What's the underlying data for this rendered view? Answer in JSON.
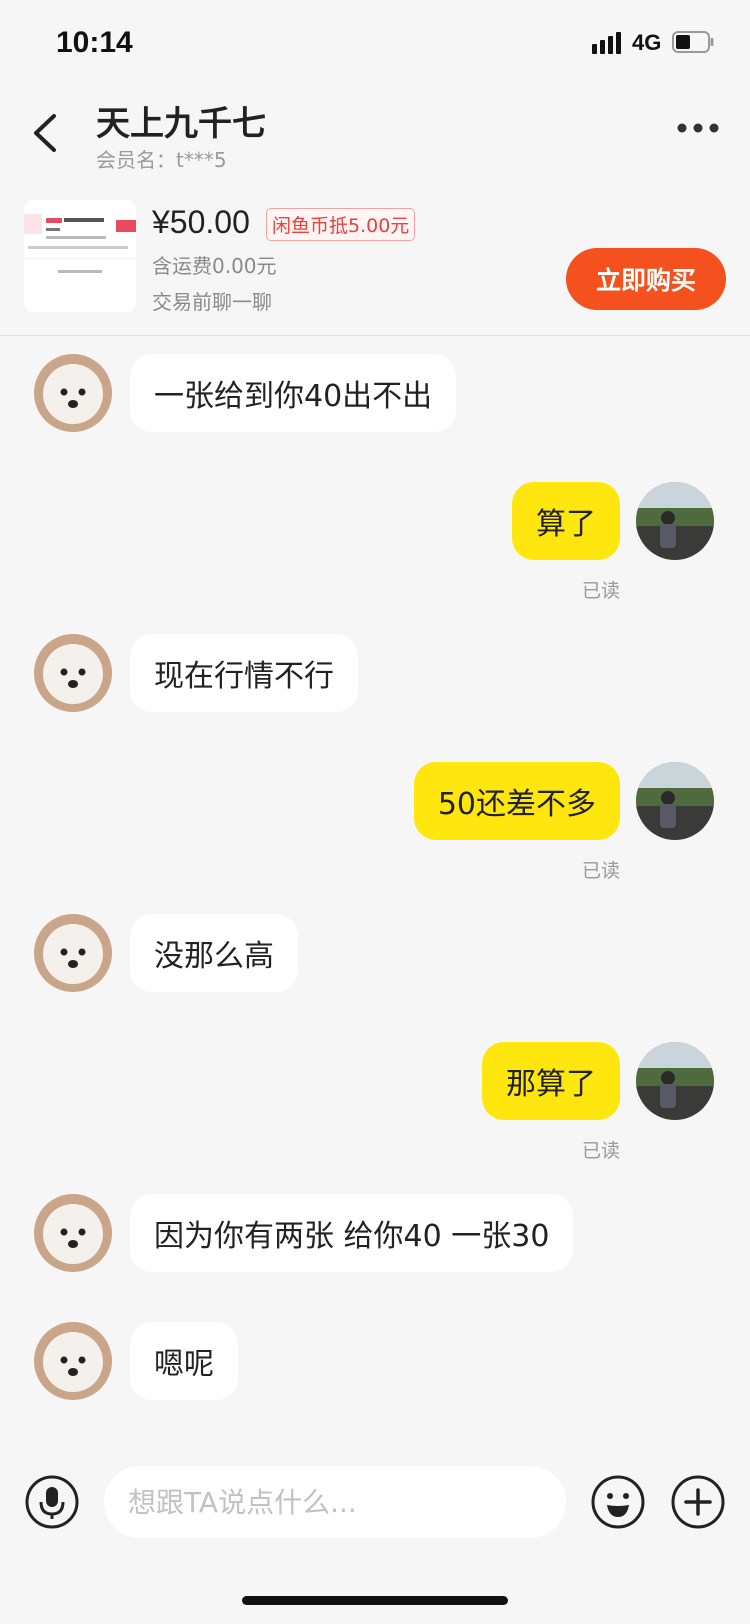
{
  "status_bar": {
    "time": "10:14",
    "network": "4G"
  },
  "header": {
    "title": "天上九千七",
    "subtitle": "会员名：t***5"
  },
  "product": {
    "price": "¥50.00",
    "coin_badge": "闲鱼币抵5.00元",
    "shipping": "含运费0.00元",
    "note": "交易前聊一聊",
    "buy_label": "立即购买"
  },
  "messages": [
    {
      "side": "left",
      "text": "一张给到你40出不出"
    },
    {
      "side": "right",
      "text": "算了",
      "status": "已读"
    },
    {
      "side": "left",
      "text": "现在行情不行"
    },
    {
      "side": "right",
      "text": "50还差不多",
      "status": "已读"
    },
    {
      "side": "left",
      "text": "没那么高"
    },
    {
      "side": "right",
      "text": "那算了",
      "status": "已读"
    },
    {
      "side": "left",
      "text": "因为你有两张  给你40  一张30"
    },
    {
      "side": "left",
      "text": "嗯呢"
    }
  ],
  "input": {
    "placeholder": "想跟TA说点什么..."
  },
  "icons": {
    "back": "chevron-left-icon",
    "more": "more-dots-icon",
    "mic": "microphone-icon",
    "emoji": "emoji-icon",
    "plus": "plus-icon"
  },
  "colors": {
    "accent": "#f4511e",
    "bubble_self": "#ffe60f",
    "bubble_other": "#ffffff",
    "coin_badge": "#e8413e"
  }
}
